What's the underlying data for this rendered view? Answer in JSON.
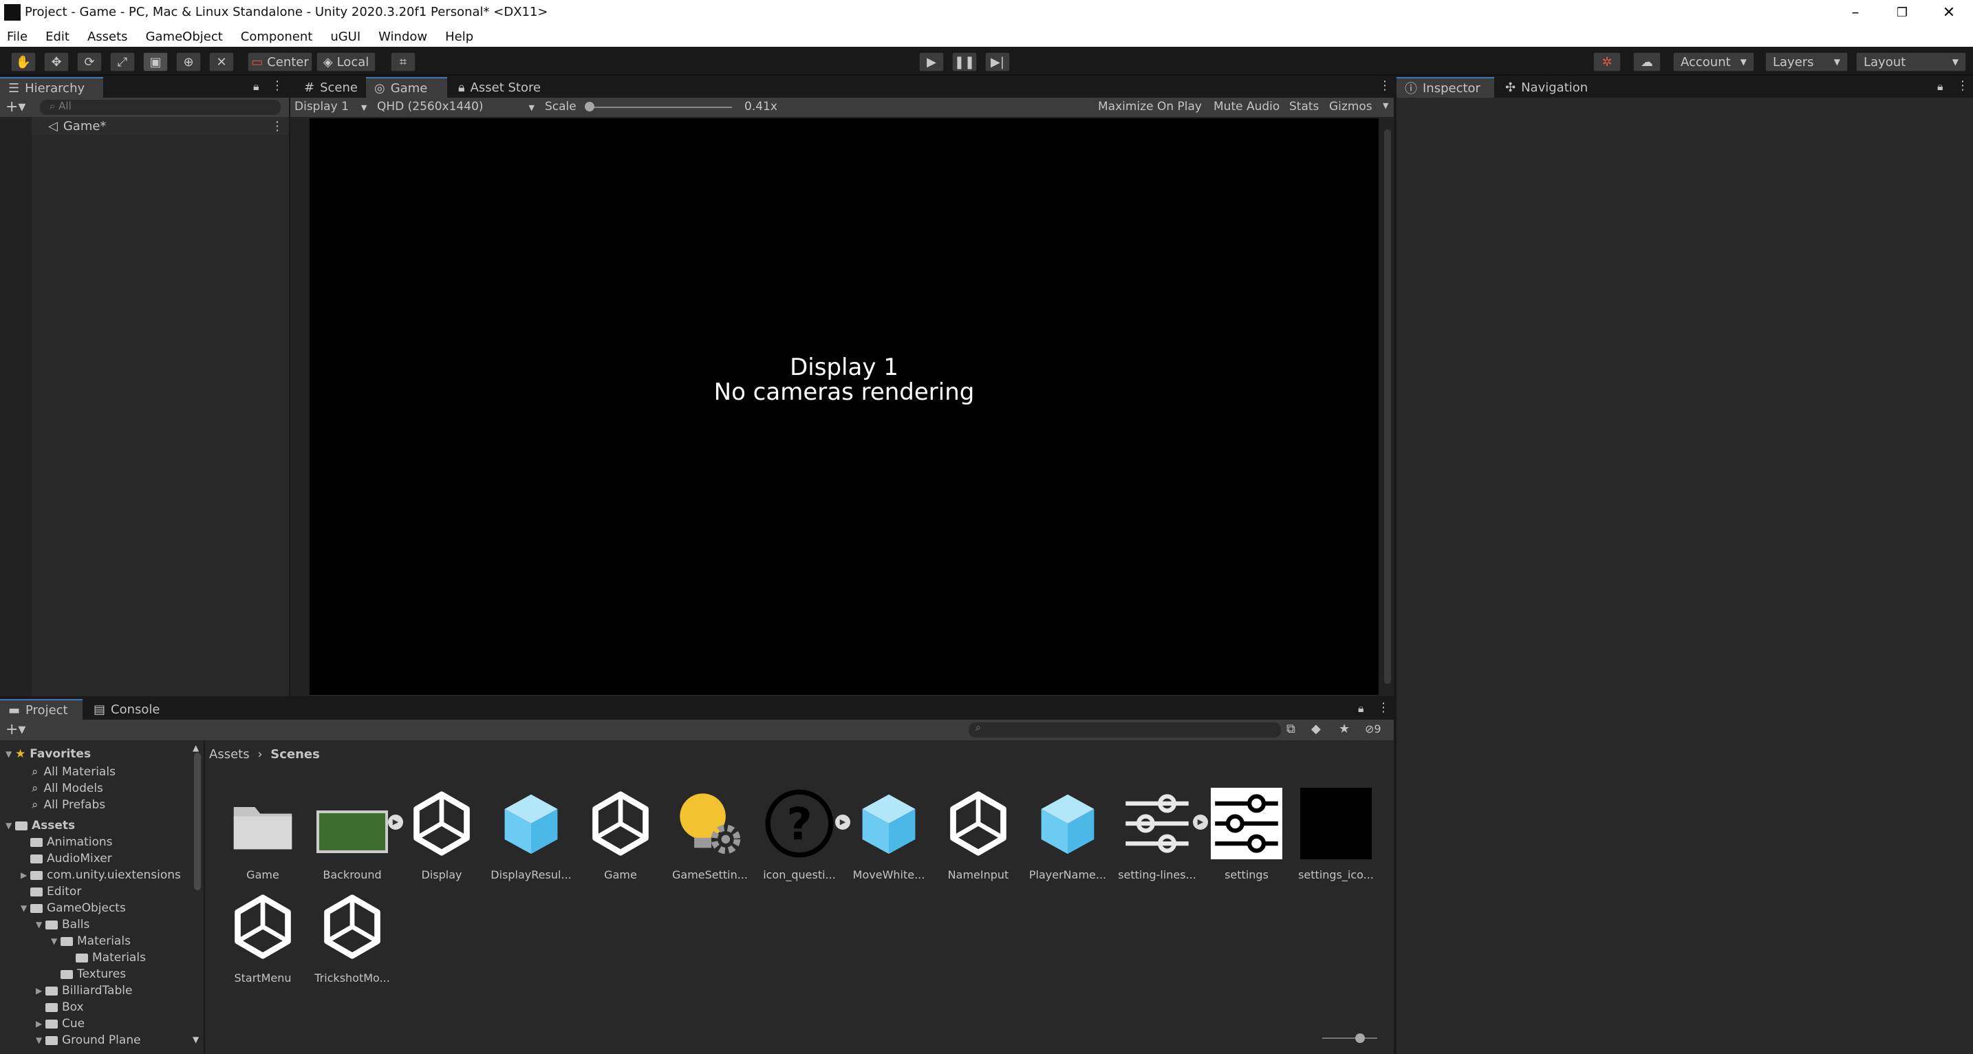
{
  "window": {
    "title": "Project - Game - PC, Mac & Linux Standalone - Unity 2020.3.20f1 Personal* <DX11>"
  },
  "menu": [
    "File",
    "Edit",
    "Assets",
    "GameObject",
    "Component",
    "uGUI",
    "Window",
    "Help"
  ],
  "toolbar": {
    "pivot": "Center",
    "space": "Local",
    "account": "Account",
    "layers": "Layers",
    "layout": "Layout"
  },
  "hierarchy": {
    "tab": "Hierarchy",
    "search_placeholder": "All",
    "root": "Game*"
  },
  "game_view": {
    "tabs": [
      "Scene",
      "Game",
      "Asset Store"
    ],
    "display": "Display 1",
    "resolution": "QHD (2560x1440)",
    "scale_label": "Scale",
    "scale_value": "0.41x",
    "options": [
      "Maximize On Play",
      "Mute Audio",
      "Stats",
      "Gizmos"
    ],
    "message_line1": "Display 1",
    "message_line2": "No cameras rendering"
  },
  "inspector": {
    "tabs": [
      "Inspector",
      "Navigation"
    ]
  },
  "project": {
    "tabs": [
      "Project",
      "Console"
    ],
    "hidden_count": "9",
    "breadcrumb": [
      "Assets",
      "Scenes"
    ],
    "favorites_label": "Favorites",
    "favorites": [
      "All Materials",
      "All Models",
      "All Prefabs"
    ],
    "assets_label": "Assets",
    "tree": [
      {
        "label": "Animations",
        "depth": 1,
        "arrow": ""
      },
      {
        "label": "AudioMixer",
        "depth": 1,
        "arrow": ""
      },
      {
        "label": "com.unity.uiextensions",
        "depth": 1,
        "arrow": "▶"
      },
      {
        "label": "Editor",
        "depth": 1,
        "arrow": ""
      },
      {
        "label": "GameObjects",
        "depth": 1,
        "arrow": "▼"
      },
      {
        "label": "Balls",
        "depth": 2,
        "arrow": "▼"
      },
      {
        "label": "Materials",
        "depth": 3,
        "arrow": "▼"
      },
      {
        "label": "Materials",
        "depth": 4,
        "arrow": ""
      },
      {
        "label": "Textures",
        "depth": 3,
        "arrow": ""
      },
      {
        "label": "BilliardTable",
        "depth": 2,
        "arrow": "▶"
      },
      {
        "label": "Box",
        "depth": 2,
        "arrow": ""
      },
      {
        "label": "Cue",
        "depth": 2,
        "arrow": "▶"
      },
      {
        "label": "Ground Plane",
        "depth": 2,
        "arrow": "▼"
      }
    ],
    "assets": [
      {
        "label": "Game",
        "kind": "folder"
      },
      {
        "label": "Backround",
        "kind": "image"
      },
      {
        "label": "Display",
        "kind": "scene"
      },
      {
        "label": "DisplayResul...",
        "kind": "prefab"
      },
      {
        "label": "Game",
        "kind": "scene"
      },
      {
        "label": "GameSettin...",
        "kind": "settings"
      },
      {
        "label": "icon_questi...",
        "kind": "question"
      },
      {
        "label": "MoveWhite...",
        "kind": "prefab"
      },
      {
        "label": "NameInput",
        "kind": "scene"
      },
      {
        "label": "PlayerName...",
        "kind": "prefab"
      },
      {
        "label": "setting-lines...",
        "kind": "sliders-dark"
      },
      {
        "label": "settings",
        "kind": "sliders"
      },
      {
        "label": "settings_ico...",
        "kind": "black"
      },
      {
        "label": "StartMenu",
        "kind": "scene"
      },
      {
        "label": "TrickshotMo...",
        "kind": "scene"
      }
    ]
  }
}
